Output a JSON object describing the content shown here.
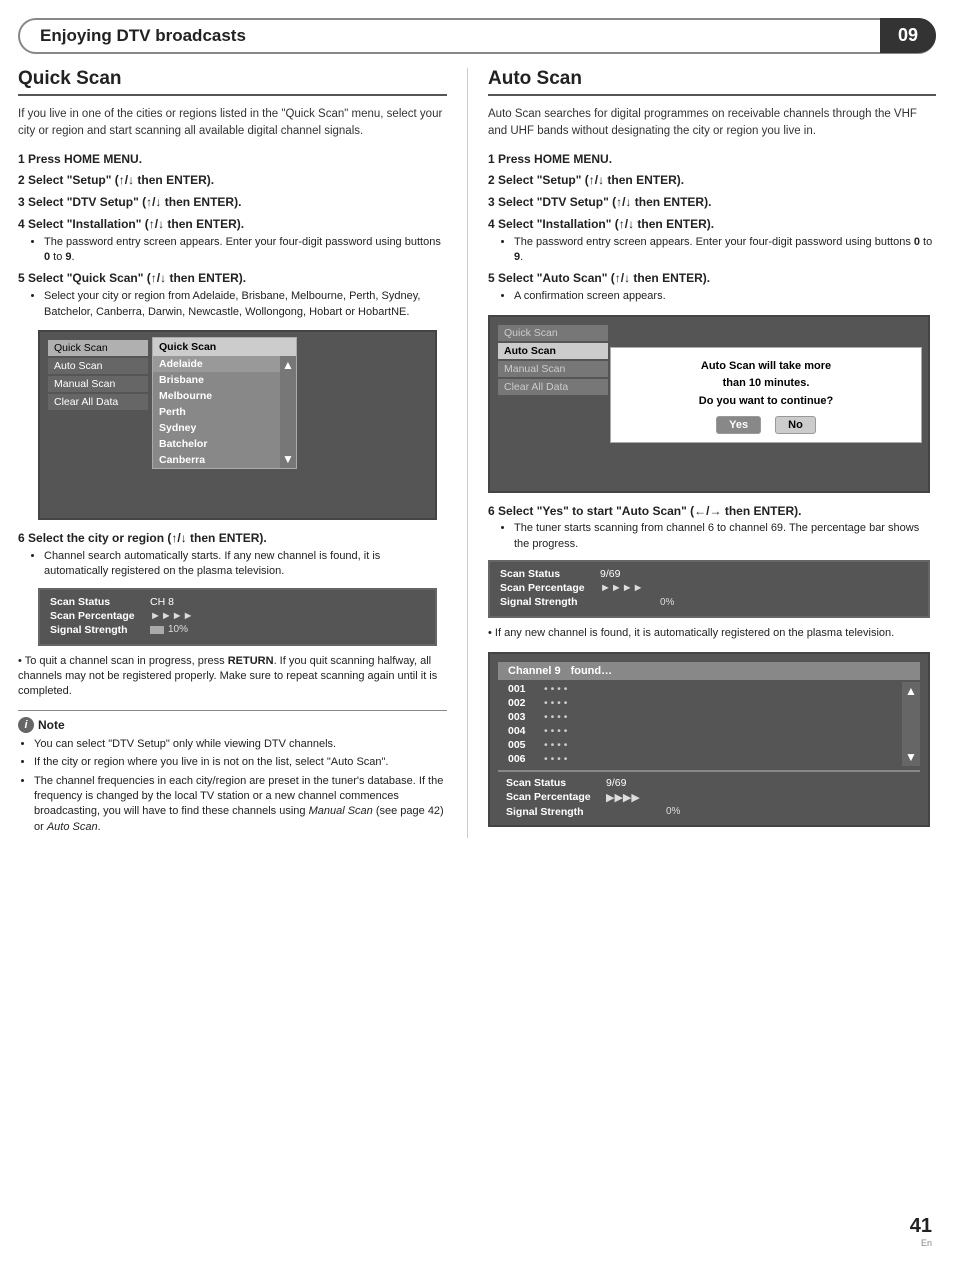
{
  "header": {
    "title": "Enjoying DTV broadcasts",
    "page_number": "09"
  },
  "quick_scan": {
    "title": "Quick Scan",
    "intro": "If you live in one of the cities or regions listed in the \"Quick Scan\" menu, select your city or region and start scanning all available digital channel signals.",
    "steps": [
      {
        "num": "1",
        "text": "Press HOME MENU."
      },
      {
        "num": "2",
        "text": "Select “Setup” (↑/↓ then ENTER)."
      },
      {
        "num": "3",
        "text": "Select “DTV Setup” (↑/↓ then ENTER)."
      },
      {
        "num": "4",
        "text": "Select “Installation” (↑/↓ then ENTER).",
        "sub": [
          "The password entry screen appears. Enter your four-digit password using buttons 0 to 9."
        ]
      },
      {
        "num": "5",
        "text": "Select “Quick Scan” (↑/↓ then ENTER).",
        "sub": [
          "Select your city or region from Adelaide, Brisbane, Melbourne, Perth, Sydney, Batchelor, Canberra, Darwin, Newcastle, Wollongong, Hobart or HobartNE."
        ]
      },
      {
        "num": "6",
        "text": "Select the city or region (↑/↓ then ENTER).",
        "sub": [
          "Channel search automatically starts. If any new channel is found, it is automatically registered on the plasma television."
        ]
      }
    ],
    "screen1": {
      "menu_items": [
        "Quick Scan",
        "Auto Scan",
        "Manual Scan",
        "Clear All Data"
      ],
      "popup_title": "Quick Scan",
      "popup_items": [
        "Adelaide",
        "Brisbane",
        "Melbourne",
        "Perth",
        "Sydney",
        "Batchelor",
        "Canberra"
      ]
    },
    "scan_status": {
      "label1": "Scan Status",
      "val1": "CH 8",
      "label2": "Scan Percentage",
      "arrows2": "►►►►",
      "label3": "Signal Strength",
      "val3": "10%"
    },
    "quit_note": "To quit a channel scan in progress, press RETURN. If you quit scanning halfway, all channels may not be registered properly. Make sure to repeat scanning again until it is completed.",
    "notes": [
      "You can select “DTV Setup” only while viewing DTV channels.",
      "If the city or region where you live in is not on the list, select “Auto Scan”.",
      "The channel frequencies in each city/region are preset in the tuner’s database. If the frequency is changed by the local TV station or a new channel commences broadcasting, you will have to find these channels using Manual Scan (see page 42) or Auto Scan."
    ]
  },
  "auto_scan": {
    "title": "Auto Scan",
    "intro": "Auto Scan searches for digital programmes on receivable channels through the VHF and UHF bands without designating the city or region you live in.",
    "steps": [
      {
        "num": "1",
        "text": "Press HOME MENU."
      },
      {
        "num": "2",
        "text": "Select “Setup” (↑/↓ then ENTER)."
      },
      {
        "num": "3",
        "text": "Select “DTV Setup” (↑/↓ then ENTER)."
      },
      {
        "num": "4",
        "text": "Select “Installation” (↑/↓ then ENTER).",
        "sub": [
          "The password entry screen appears. Enter your four-digit password using buttons 0 to 9."
        ]
      },
      {
        "num": "5",
        "text": "Select “Auto Scan” (↑/↓ then ENTER).",
        "sub": [
          "A confirmation screen appears."
        ]
      },
      {
        "num": "6",
        "text": "Select “Yes” to start “Auto Scan” (←/→ then ENTER).",
        "sub": [
          "The tuner starts scanning from channel 6 to channel 69. The percentage bar shows the progress."
        ]
      }
    ],
    "screen1": {
      "menu_items": [
        "Quick Scan",
        "Auto Scan",
        "Manual Scan",
        "Clear All Data"
      ],
      "confirm_line1": "Auto Scan will take more",
      "confirm_line2": "than 10 minutes.",
      "confirm_line3": "Do you want to continue?",
      "btn_yes": "Yes",
      "btn_no": "No"
    },
    "scan_status": {
      "label1": "Scan Status",
      "val1": "9/69",
      "label2": "Scan Percentage",
      "arrows2": "►►►►",
      "label3": "Signal Strength",
      "val3": "0%"
    },
    "after_note": "If any new channel is found, it is automatically registered on the plasma television.",
    "channel_found": {
      "header": "Channel 9   found…",
      "rows": [
        "001",
        "002",
        "003",
        "004",
        "005",
        "006"
      ]
    },
    "scan_status2": {
      "label1": "Scan Status",
      "val1": "9/69",
      "label2": "Scan Percentage",
      "arrows2": "►►►►",
      "label3": "Signal Strength",
      "val3": "0%"
    }
  },
  "footer": {
    "page_num": "41",
    "lang": "En"
  }
}
